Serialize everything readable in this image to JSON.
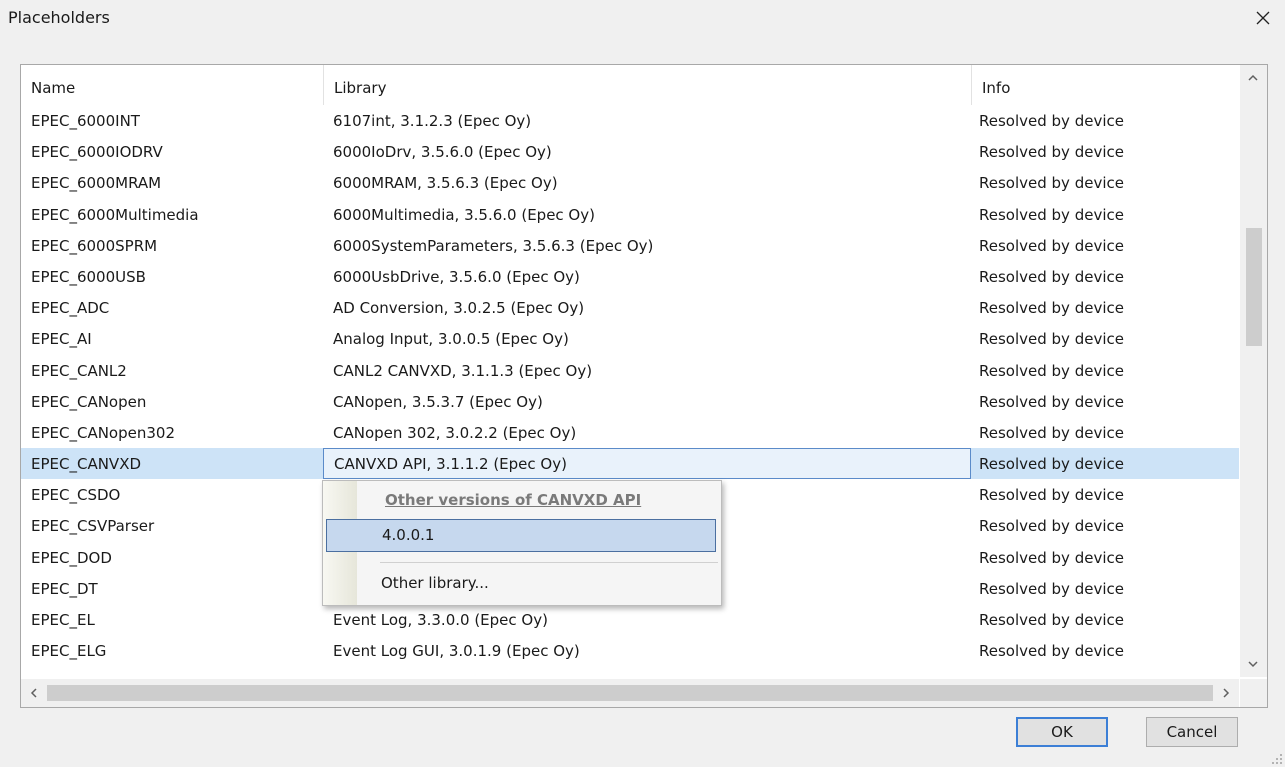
{
  "window": {
    "title": "Placeholders"
  },
  "table": {
    "columns": [
      "Name",
      "Library",
      "Info"
    ],
    "rows": [
      {
        "name": "EPEC_6000INT",
        "library": "6107int, 3.1.2.3 (Epec Oy)",
        "info": "Resolved by device"
      },
      {
        "name": "EPEC_6000IODRV",
        "library": "6000IoDrv, 3.5.6.0 (Epec Oy)",
        "info": "Resolved by device"
      },
      {
        "name": "EPEC_6000MRAM",
        "library": "6000MRAM, 3.5.6.3 (Epec Oy)",
        "info": "Resolved by device"
      },
      {
        "name": "EPEC_6000Multimedia",
        "library": "6000Multimedia, 3.5.6.0 (Epec Oy)",
        "info": "Resolved by device"
      },
      {
        "name": "EPEC_6000SPRM",
        "library": "6000SystemParameters, 3.5.6.3 (Epec Oy)",
        "info": "Resolved by device"
      },
      {
        "name": "EPEC_6000USB",
        "library": "6000UsbDrive, 3.5.6.0 (Epec Oy)",
        "info": "Resolved by device"
      },
      {
        "name": "EPEC_ADC",
        "library": "AD Conversion, 3.0.2.5 (Epec Oy)",
        "info": "Resolved by device"
      },
      {
        "name": "EPEC_AI",
        "library": "Analog Input, 3.0.0.5 (Epec Oy)",
        "info": "Resolved by device"
      },
      {
        "name": "EPEC_CANL2",
        "library": "CANL2 CANVXD, 3.1.1.3 (Epec Oy)",
        "info": "Resolved by device"
      },
      {
        "name": "EPEC_CANopen",
        "library": "CANopen, 3.5.3.7 (Epec Oy)",
        "info": "Resolved by device"
      },
      {
        "name": "EPEC_CANopen302",
        "library": "CANopen 302, 3.0.2.2 (Epec Oy)",
        "info": "Resolved by device"
      },
      {
        "name": "EPEC_CANVXD",
        "library": "CANVXD API, 3.1.1.2 (Epec Oy)",
        "info": "Resolved by device"
      },
      {
        "name": "EPEC_CSDO",
        "library": "",
        "info": "Resolved by device"
      },
      {
        "name": "EPEC_CSVParser",
        "library": "",
        "info": "Resolved by device"
      },
      {
        "name": "EPEC_DOD",
        "library": "",
        "info": "Resolved by device"
      },
      {
        "name": "EPEC_DT",
        "library": "",
        "info": "Resolved by device"
      },
      {
        "name": "EPEC_EL",
        "library": "Event Log, 3.3.0.0 (Epec Oy)",
        "info": "Resolved by device"
      },
      {
        "name": "EPEC_ELG",
        "library": "Event Log GUI, 3.0.1.9 (Epec Oy)",
        "info": "Resolved by device"
      }
    ],
    "selected_row": "EPEC_CANVXD"
  },
  "popup": {
    "group_title": "Other versions of CANVXD API",
    "version_item": "4.0.0.1",
    "other_item": "Other library..."
  },
  "buttons": {
    "ok": "OK",
    "cancel": "Cancel"
  },
  "icons": [
    "close-icon",
    "scroll-up-icon",
    "scroll-down-icon",
    "scroll-left-icon",
    "scroll-right-icon",
    "resize-grip-icon"
  ],
  "colors": {
    "selection": "#cde3f7",
    "selection_border": "#5b8bc9",
    "popup_highlight": "#c6d8ee",
    "default_button_border": "#3c7fd6"
  }
}
